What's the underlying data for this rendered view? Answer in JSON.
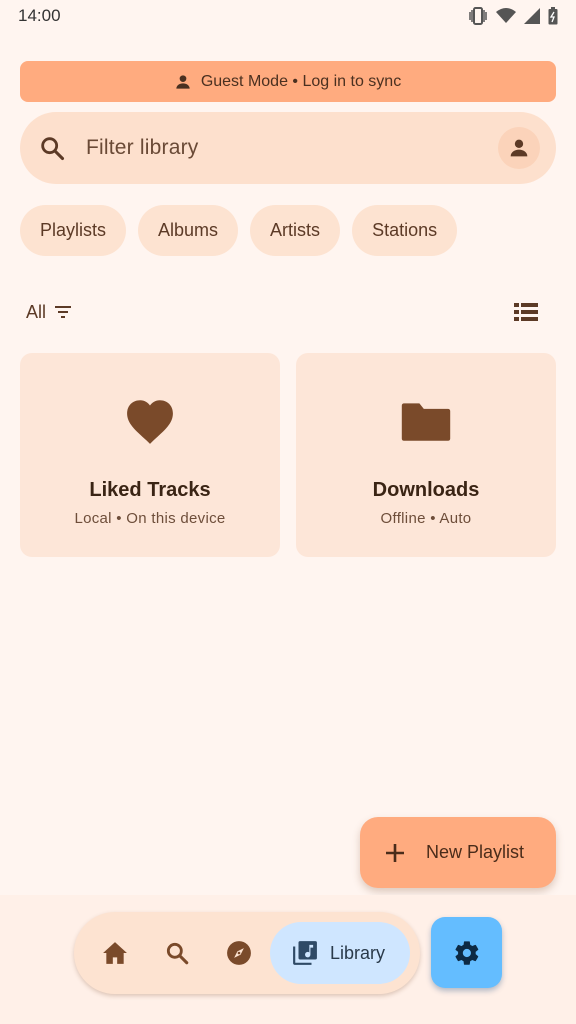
{
  "status_bar": {
    "time": "14:00",
    "icons": [
      "vibrate-icon",
      "wifi-icon",
      "signal-icon",
      "battery-icon"
    ]
  },
  "guest_banner": {
    "text": "Guest Mode • Log in to sync",
    "icon": "person-icon"
  },
  "search": {
    "placeholder": "Filter library",
    "icon": "search-icon",
    "account_icon": "account-icon"
  },
  "chips": [
    {
      "label": "Playlists"
    },
    {
      "label": "Albums"
    },
    {
      "label": "Artists"
    },
    {
      "label": "Stations"
    }
  ],
  "filter": {
    "label": "All",
    "sort_icon": "sort-icon",
    "view_icon": "list-view-icon"
  },
  "cards": [
    {
      "title": "Liked Tracks",
      "subtitle": "Local • On this device",
      "icon": "heart-icon"
    },
    {
      "title": "Downloads",
      "subtitle": "Offline • Auto",
      "icon": "folder-icon"
    }
  ],
  "fab": {
    "label": "New Playlist",
    "icon": "plus-icon"
  },
  "bottom_nav": {
    "items": [
      {
        "icon": "home-icon"
      },
      {
        "icon": "search-icon"
      },
      {
        "icon": "explore-icon"
      }
    ],
    "active": {
      "label": "Library",
      "icon": "library-music-icon"
    },
    "settings_icon": "gear-icon"
  },
  "colors": {
    "background": "#fff5f0",
    "accent": "#ffab7f",
    "card": "#fde6d8",
    "icon_brown": "#7a4a2a",
    "active_nav": "#cfe6ff",
    "settings_button": "#64bdff"
  }
}
